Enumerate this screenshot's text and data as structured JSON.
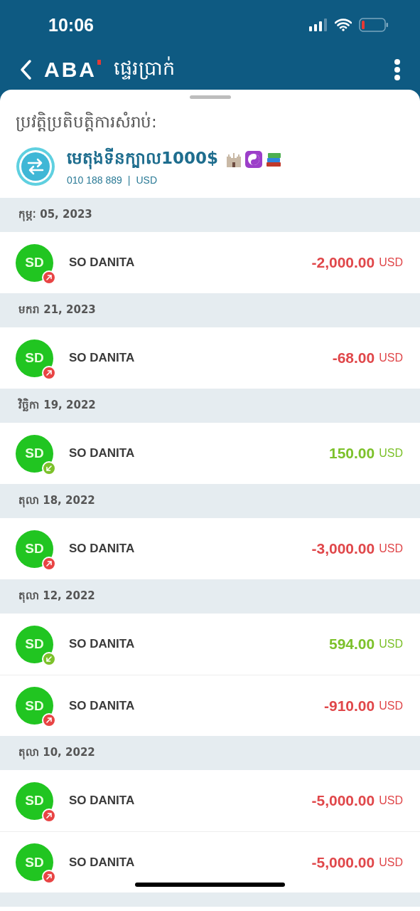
{
  "status_bar": {
    "time": "10:06"
  },
  "header": {
    "brand": "ABA",
    "title": "ផ្ទេរប្រាក់"
  },
  "sheet": {
    "title": "ប្រវត្តិប្រតិបត្តិការសំរាប់:",
    "account": {
      "name": "មេតុងទីនក្បាល1000$",
      "number": "010 188 889",
      "separator": "|",
      "currency": "USD"
    }
  },
  "groups": [
    {
      "date": "កុម្ភៈ 05, 2023",
      "transactions": [
        {
          "initials": "SD",
          "name": "SO DANITA",
          "kind": "out",
          "amount": "-2,000.00",
          "currency": "USD"
        }
      ]
    },
    {
      "date": "មករា 21, 2023",
      "transactions": [
        {
          "initials": "SD",
          "name": "SO DANITA",
          "kind": "out",
          "amount": "-68.00",
          "currency": "USD"
        }
      ]
    },
    {
      "date": "វិច្ឆិកា 19, 2022",
      "transactions": [
        {
          "initials": "SD",
          "name": "SO DANITA",
          "kind": "in",
          "amount": "150.00",
          "currency": "USD"
        }
      ]
    },
    {
      "date": "តុលា 18, 2022",
      "transactions": [
        {
          "initials": "SD",
          "name": "SO DANITA",
          "kind": "out",
          "amount": "-3,000.00",
          "currency": "USD"
        }
      ]
    },
    {
      "date": "តុលា 12, 2022",
      "transactions": [
        {
          "initials": "SD",
          "name": "SO DANITA",
          "kind": "in",
          "amount": "594.00",
          "currency": "USD"
        },
        {
          "initials": "SD",
          "name": "SO DANITA",
          "kind": "out",
          "amount": "-910.00",
          "currency": "USD"
        }
      ]
    },
    {
      "date": "តុលា 10, 2022",
      "transactions": [
        {
          "initials": "SD",
          "name": "SO DANITA",
          "kind": "out",
          "amount": "-5,000.00",
          "currency": "USD"
        },
        {
          "initials": "SD",
          "name": "SO DANITA",
          "kind": "out",
          "amount": "-5,000.00",
          "currency": "USD"
        }
      ]
    }
  ]
}
